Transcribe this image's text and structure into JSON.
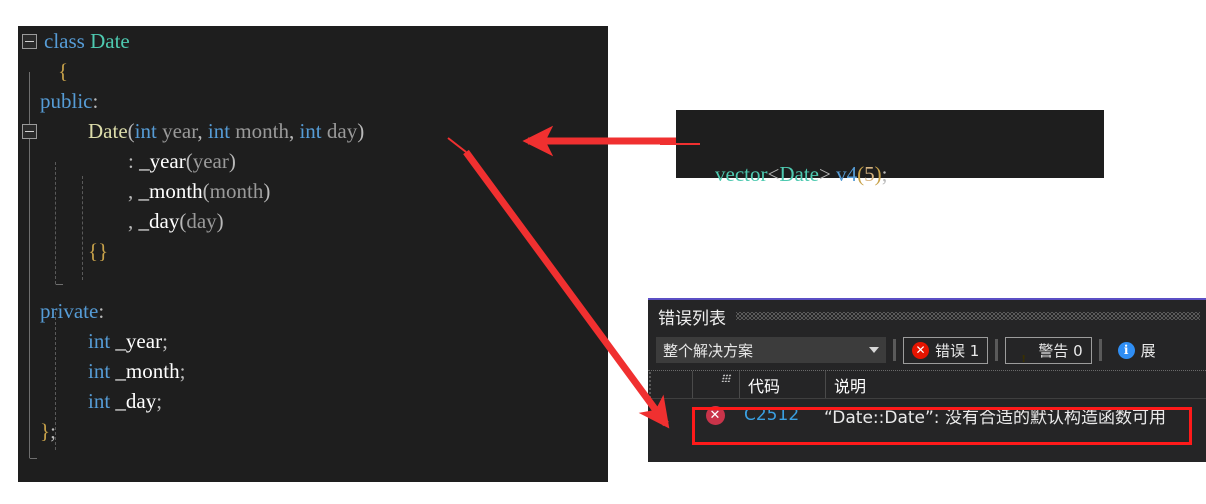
{
  "editor": {
    "name": "code-editor",
    "background": "#1e1e1e",
    "lines": [
      {
        "indent": 0,
        "text": "class Date"
      },
      {
        "indent": 0,
        "text": "{"
      },
      {
        "indent": 0,
        "text": "public:"
      },
      {
        "indent": 0,
        "text": "Date(int year, int month, int day)"
      },
      {
        "indent": 0,
        "text": ": _year(year)"
      },
      {
        "indent": 0,
        "text": ", _month(month)"
      },
      {
        "indent": 0,
        "text": ", _day(day)"
      },
      {
        "indent": 0,
        "text": "{}"
      },
      {
        "indent": 0,
        "text": ""
      },
      {
        "indent": 0,
        "text": "private:"
      },
      {
        "indent": 0,
        "text": "int _year;"
      },
      {
        "indent": 0,
        "text": "int _month;"
      },
      {
        "indent": 0,
        "text": "int _day;"
      },
      {
        "indent": 0,
        "text": "};"
      }
    ],
    "tokens": {
      "l0": [
        {
          "t": "class ",
          "c": "t-kw"
        },
        {
          "t": "Date",
          "c": "t-type"
        }
      ],
      "l1": [
        {
          "t": "{",
          "c": "t-brace"
        }
      ],
      "l2": [
        {
          "t": "public",
          "c": "t-kw"
        },
        {
          "t": ":",
          "c": "t-punc"
        }
      ],
      "l3": [
        {
          "t": "Date",
          "c": "t-fn"
        },
        {
          "t": "(",
          "c": "t-punc"
        },
        {
          "t": "int",
          "c": "t-kw"
        },
        {
          "t": " year",
          "c": "t-param"
        },
        {
          "t": ", ",
          "c": "t-punc"
        },
        {
          "t": "int",
          "c": "t-kw"
        },
        {
          "t": " month",
          "c": "t-param"
        },
        {
          "t": ", ",
          "c": "t-punc"
        },
        {
          "t": "int",
          "c": "t-kw"
        },
        {
          "t": " day",
          "c": "t-param"
        },
        {
          "t": ")",
          "c": "t-punc"
        }
      ],
      "l4": [
        {
          "t": ": ",
          "c": "t-punc"
        },
        {
          "t": "_year",
          "c": "t-id"
        },
        {
          "t": "(",
          "c": "t-punc"
        },
        {
          "t": "year",
          "c": "t-param"
        },
        {
          "t": ")",
          "c": "t-punc"
        }
      ],
      "l5": [
        {
          "t": ", ",
          "c": "t-punc"
        },
        {
          "t": "_month",
          "c": "t-id"
        },
        {
          "t": "(",
          "c": "t-punc"
        },
        {
          "t": "month",
          "c": "t-param"
        },
        {
          "t": ")",
          "c": "t-punc"
        }
      ],
      "l6": [
        {
          "t": ", ",
          "c": "t-punc"
        },
        {
          "t": "_day",
          "c": "t-id"
        },
        {
          "t": "(",
          "c": "t-punc"
        },
        {
          "t": "day",
          "c": "t-param"
        },
        {
          "t": ")",
          "c": "t-punc"
        }
      ],
      "l7": [
        {
          "t": "{}",
          "c": "t-brace"
        }
      ],
      "l8": [],
      "l9": [
        {
          "t": "private",
          "c": "t-kw"
        },
        {
          "t": ":",
          "c": "t-punc"
        }
      ],
      "l10": [
        {
          "t": "int",
          "c": "t-kw"
        },
        {
          "t": " _year",
          "c": "t-id"
        },
        {
          "t": ";",
          "c": "t-punc"
        }
      ],
      "l11": [
        {
          "t": "int",
          "c": "t-kw"
        },
        {
          "t": " _month",
          "c": "t-id"
        },
        {
          "t": ";",
          "c": "t-punc"
        }
      ],
      "l12": [
        {
          "t": "int",
          "c": "t-kw"
        },
        {
          "t": " _day",
          "c": "t-id"
        },
        {
          "t": ";",
          "c": "t-punc"
        }
      ],
      "l13": [
        {
          "t": "}",
          "c": "t-brace"
        },
        {
          "t": ";",
          "c": "t-punc"
        }
      ]
    }
  },
  "vector_snippet": {
    "name": "vector-snippet",
    "text": "vector<Date> v4(5);",
    "tokens": [
      {
        "t": "vector",
        "c": "t-type"
      },
      {
        "t": "<",
        "c": "t-punc"
      },
      {
        "t": "Date",
        "c": "t-type"
      },
      {
        "t": "> ",
        "c": "t-punc"
      },
      {
        "t": "v4",
        "c": "t-kw"
      },
      {
        "t": "(",
        "c": "t-brace"
      },
      {
        "t": "5",
        "c": "t-num"
      },
      {
        "t": ")",
        "c": "t-brace"
      },
      {
        "t": ";",
        "c": "t-punc"
      }
    ]
  },
  "error_panel": {
    "title": "错误列表",
    "scope_selected": "整个解决方案",
    "toolbar": {
      "errors_label": "错误 1",
      "errors_count": 1,
      "warnings_label": "警告 0",
      "warnings_count": 0,
      "messages_label": "展",
      "error_icon": "error-circle-icon",
      "warning_icon": "warning-triangle-icon",
      "info_icon": "info-circle-icon",
      "caret_icon": "chevron-down-icon"
    },
    "columns": [
      "代码",
      "说明"
    ],
    "rows": [
      {
        "severity_icon": "error-circle-icon",
        "code": "C2512",
        "description": "“Date::Date”: 没有合适的默认构造函数可用"
      }
    ]
  },
  "annotations": {
    "highlight_color": "#ff1a1a",
    "arrow_color": "#f03030",
    "arrow_to_constructor": "arrow-pointing-to-constructor",
    "arrow_to_error_row": "arrow-pointing-to-error-row"
  },
  "glyphs": {
    "error_x": "✕",
    "warning_bang": "!",
    "info_i": "i"
  }
}
